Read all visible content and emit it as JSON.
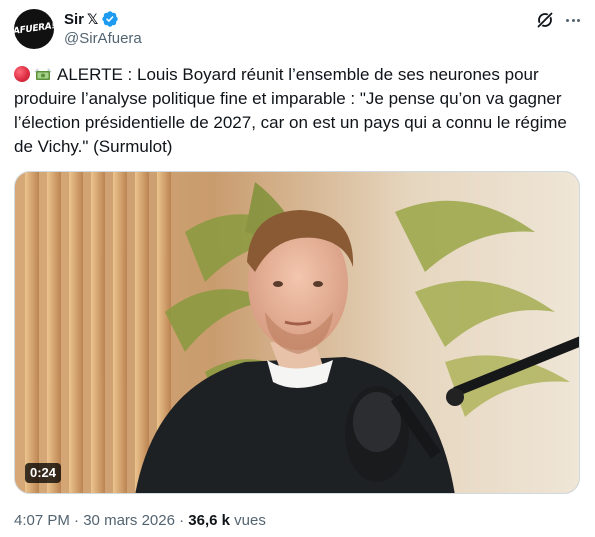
{
  "author": {
    "avatar_text": "AFUERA!",
    "display_name": "Sir",
    "name_badge": "𝕏",
    "handle": "@SirAfuera",
    "verified": true
  },
  "tweet": {
    "prefix": "ALERTE : ",
    "body": "Louis Boyard réunit l’ensemble de ses neurones pour\nproduire l’analyse politique fine et imparable : \"Je pense qu’on va gagner\nl’élection présidentielle de 2027, car on est un pays qui a connu le régime\nde Vichy.\" (Surmulot)"
  },
  "media": {
    "type": "video",
    "duration": "0:24"
  },
  "meta": {
    "time": "4:07 PM",
    "separator": " · ",
    "date": "30 mars 2026",
    "views_count": "36,6 k",
    "views_label": " vues"
  },
  "colors": {
    "text": "#0f1419",
    "secondary": "#536471",
    "verified": "#1d9bf0",
    "border": "#cfd9de"
  }
}
